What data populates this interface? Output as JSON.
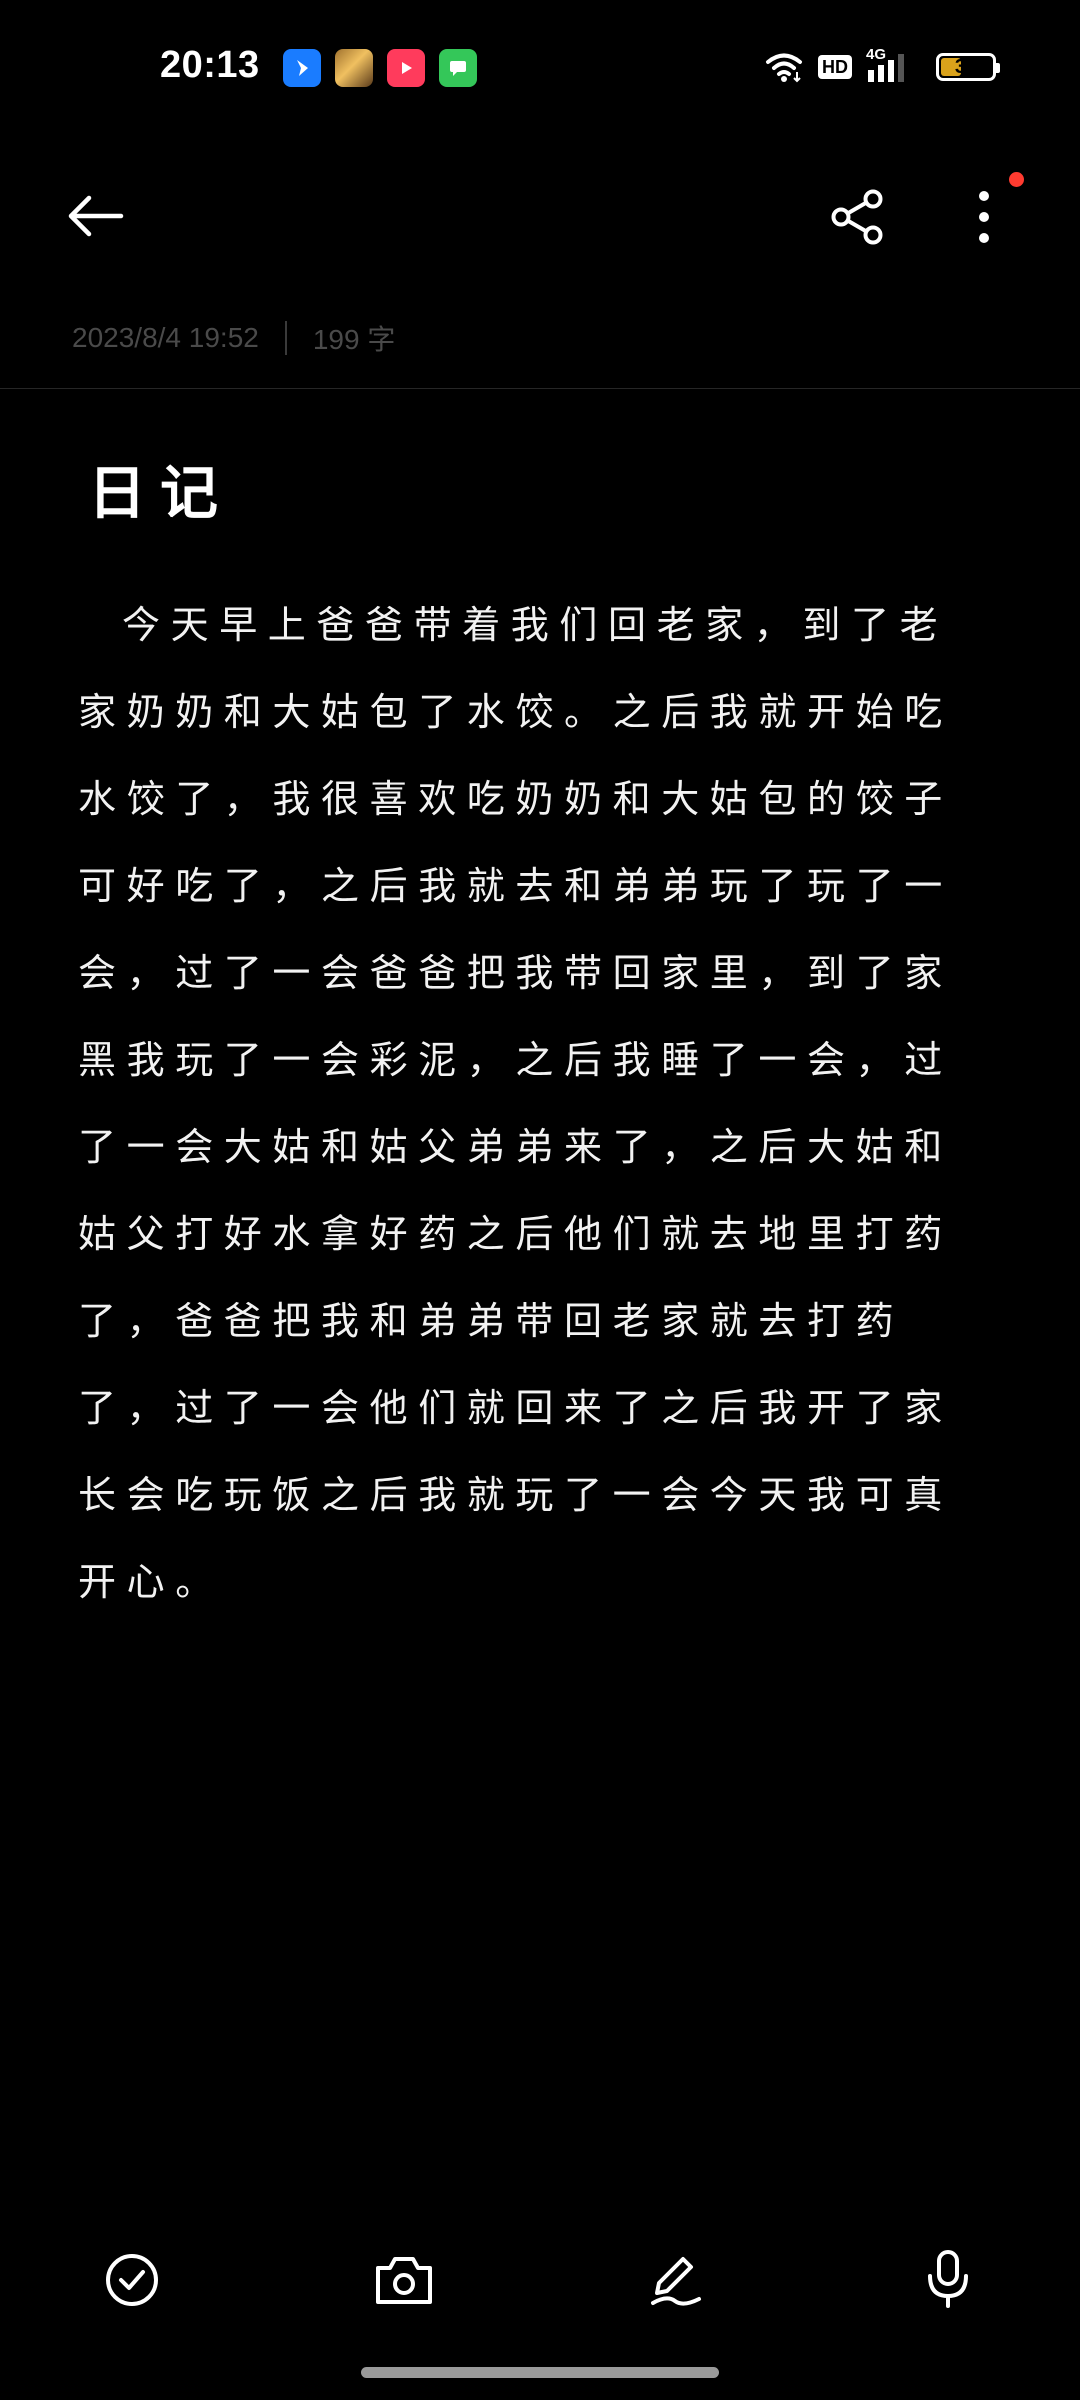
{
  "status_bar": {
    "time": "20:13",
    "network": "4G",
    "hd_label": "HD",
    "battery_level": "39",
    "battery_fraction": 0.39,
    "battery_color": "#d9a21b",
    "app_icons": [
      "blue-app-icon",
      "game-app-icon",
      "video-app-icon",
      "messages-app-icon"
    ]
  },
  "toolbar": {
    "back_icon": "arrow-left-icon",
    "share_icon": "share-icon",
    "more_icon": "more-vertical-icon",
    "has_notification": true,
    "notification_color": "#ff3b30"
  },
  "note": {
    "date": "2023/8/4 19:52",
    "word_count": "199 字",
    "title": "日记",
    "body": "今天早上爸爸带着我们回老家，到了老家奶奶和大姑包了水饺。之后我就开始吃水饺了，我很喜欢吃奶奶和大姑包的饺子可好吃了，之后我就去和弟弟玩了玩了一会，过了一会爸爸把我带回家里，到了家黑我玩了一会彩泥，之后我睡了一会，过了一会大姑和姑父弟弟来了，之后大姑和姑父打好水拿好药之后他们就去地里打药了，爸爸把我和弟弟带回老家就去打药了，过了一会他们就回来了之后我开了家长会吃玩饭之后我就玩了一会今天我可真开心。"
  },
  "bottom_bar": {
    "icons": [
      "checklist-icon",
      "camera-icon",
      "handwriting-icon",
      "microphone-icon"
    ]
  }
}
